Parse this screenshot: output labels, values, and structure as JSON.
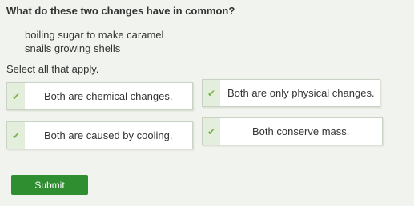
{
  "question": "What do these two changes have in common?",
  "changes": [
    "boiling sugar to make caramel",
    "snails growing shells"
  ],
  "instruction": "Select all that apply.",
  "choices": [
    {
      "label": "Both are chemical changes."
    },
    {
      "label": "Both are only physical changes."
    },
    {
      "label": "Both are caused by cooling."
    },
    {
      "label": "Both conserve mass."
    }
  ],
  "submit_label": "Submit",
  "icons": {
    "choice_marker": "checkmark-icon"
  },
  "colors": {
    "submit": "#2f8e2f",
    "check": "#79b24a"
  }
}
